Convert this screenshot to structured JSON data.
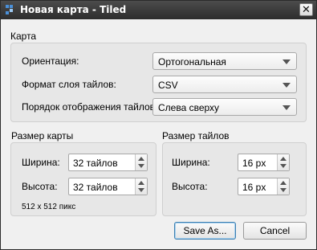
{
  "window": {
    "title": "Новая карта - Tiled",
    "close_glyph": "✕"
  },
  "map_section": {
    "title": "Карта",
    "orientation": {
      "label": "Ориентация:",
      "value": "Ортогональная"
    },
    "layer_format": {
      "label": "Формат слоя тайлов:",
      "value": "CSV"
    },
    "render_order": {
      "label": "Порядок отображения тайлов:",
      "value": "Слева сверху"
    }
  },
  "map_size": {
    "title": "Размер карты",
    "width": {
      "label": "Ширина:",
      "value": "32 тайлов"
    },
    "height": {
      "label": "Высота:",
      "value": "32 тайлов"
    },
    "pixel_size": "512 x 512 пикс"
  },
  "tile_size": {
    "title": "Размер тайлов",
    "width": {
      "label": "Ширина:",
      "value": "16 px"
    },
    "height": {
      "label": "Высота:",
      "value": "16 px"
    }
  },
  "buttons": {
    "save_as": "Save As...",
    "cancel": "Cancel"
  },
  "colors": {
    "titlebar": "#3a3a3a",
    "accent_border": "#3c7fb1",
    "icon_blue": "#4a90d9"
  },
  "icons": {
    "app": "tiled-app-icon",
    "close": "close-icon",
    "dropdown": "chevron-down-icon",
    "spin": "spin-arrows"
  }
}
